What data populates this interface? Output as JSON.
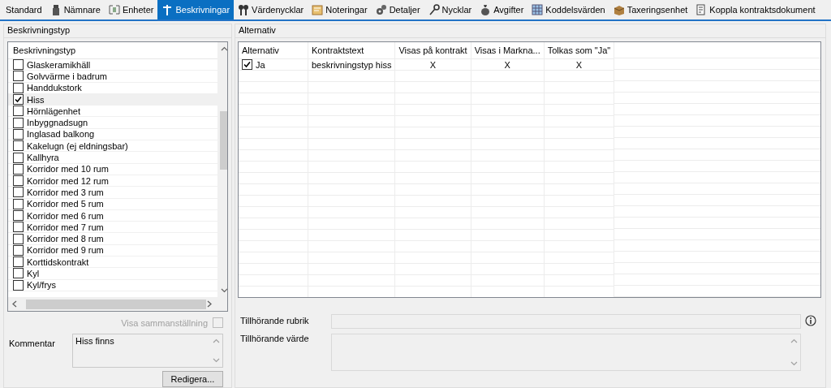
{
  "tabs": [
    {
      "label": "Standard",
      "selected": false
    },
    {
      "label": "Nämnare",
      "selected": false
    },
    {
      "label": "Enheter",
      "selected": false
    },
    {
      "label": "Beskrivningar",
      "selected": true
    },
    {
      "label": "Värdenycklar",
      "selected": false
    },
    {
      "label": "Noteringar",
      "selected": false
    },
    {
      "label": "Detaljer",
      "selected": false
    },
    {
      "label": "Nycklar",
      "selected": false
    },
    {
      "label": "Avgifter",
      "selected": false
    },
    {
      "label": "Koddelsvärden",
      "selected": false
    },
    {
      "label": "Taxeringsenhet",
      "selected": false
    },
    {
      "label": "Koppla kontraktsdokument",
      "selected": false
    }
  ],
  "types": {
    "title": "Beskrivningstyp",
    "list_header": "Beskrivningstyp",
    "items": [
      {
        "label": "Glaskeramikhäll",
        "checked": false,
        "selected": false
      },
      {
        "label": "Golvvärme i badrum",
        "checked": false,
        "selected": false
      },
      {
        "label": "Handdukstork",
        "checked": false,
        "selected": false
      },
      {
        "label": "Hiss",
        "checked": true,
        "selected": true
      },
      {
        "label": "Hörnlägenhet",
        "checked": false,
        "selected": false
      },
      {
        "label": "Inbyggnadsugn",
        "checked": false,
        "selected": false
      },
      {
        "label": "Inglasad balkong",
        "checked": false,
        "selected": false
      },
      {
        "label": "Kakelugn (ej eldningsbar)",
        "checked": false,
        "selected": false
      },
      {
        "label": "Kallhyra",
        "checked": false,
        "selected": false
      },
      {
        "label": "Korridor med 10 rum",
        "checked": false,
        "selected": false
      },
      {
        "label": "Korridor med 12 rum",
        "checked": false,
        "selected": false
      },
      {
        "label": "Korridor med 3 rum",
        "checked": false,
        "selected": false
      },
      {
        "label": "Korridor med 5 rum",
        "checked": false,
        "selected": false
      },
      {
        "label": "Korridor med 6 rum",
        "checked": false,
        "selected": false
      },
      {
        "label": "Korridor med 7 rum",
        "checked": false,
        "selected": false
      },
      {
        "label": "Korridor med 8 rum",
        "checked": false,
        "selected": false
      },
      {
        "label": "Korridor med 9 rum",
        "checked": false,
        "selected": false
      },
      {
        "label": "Korttidskontrakt",
        "checked": false,
        "selected": false
      },
      {
        "label": "Kyl",
        "checked": false,
        "selected": false
      },
      {
        "label": "Kyl/frys",
        "checked": false,
        "selected": false
      }
    ],
    "summary": {
      "label": "Visa sammanställning",
      "checked": false,
      "disabled": true
    },
    "comment": {
      "label": "Kommentar",
      "value": "Hiss finns"
    },
    "edit_button": "Redigera..."
  },
  "alternatives": {
    "title": "Alternativ",
    "columns": [
      "Alternativ",
      "Kontraktstext",
      "Visas på kontrakt",
      "Visas i Markna...",
      "Tolkas som \"Ja\""
    ],
    "rows": [
      {
        "checked": true,
        "cells": [
          "Ja",
          "beskrivningstyp hiss",
          "X",
          "X",
          "X"
        ]
      }
    ],
    "heading_field": {
      "label": "Tillhörande rubrik"
    },
    "value_field": {
      "label": "Tillhörande värde"
    }
  }
}
